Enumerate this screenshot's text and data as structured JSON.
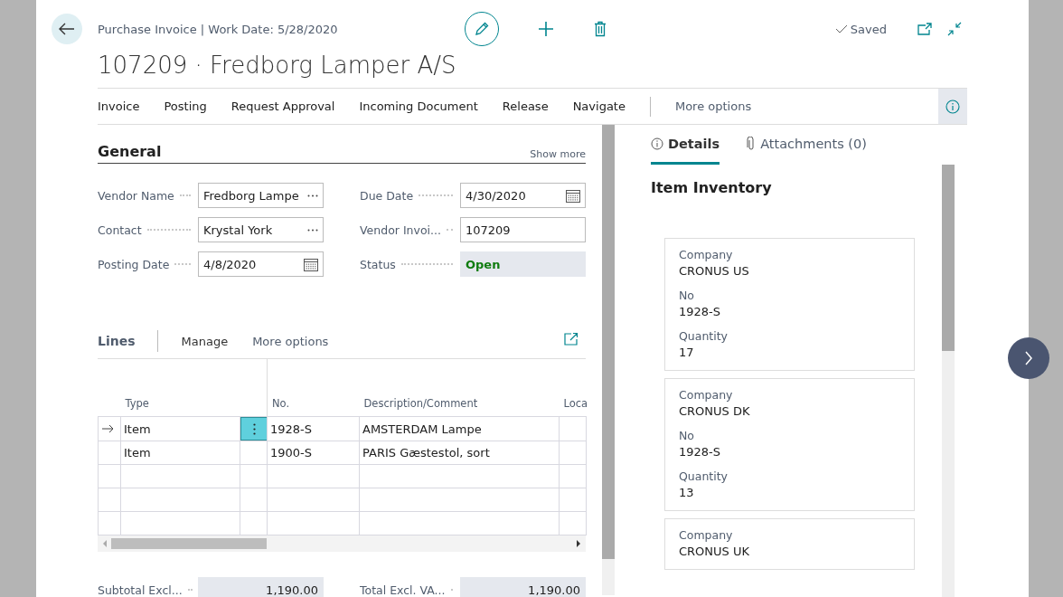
{
  "header": {
    "breadcrumb": "Purchase Invoice | Work Date: 5/28/2020",
    "title": "107209 · Fredborg Lamper A/S",
    "status": "Saved"
  },
  "action_bar": {
    "items": [
      "Invoice",
      "Posting",
      "Request Approval",
      "Incoming Document",
      "Release",
      "Navigate"
    ],
    "more": "More options"
  },
  "general": {
    "title": "General",
    "show_more": "Show more",
    "fields": [
      {
        "label": "Vendor Name",
        "value": "Fredborg Lampe",
        "kind": "lookup"
      },
      {
        "label": "Due Date",
        "value": "4/30/2020",
        "kind": "date"
      },
      {
        "label": "Contact",
        "value": "Krystal York",
        "kind": "lookup"
      },
      {
        "label": "Vendor Invoi...",
        "value": "107209",
        "kind": "text"
      },
      {
        "label": "Posting Date",
        "value": "4/8/2020",
        "kind": "date"
      },
      {
        "label": "Status",
        "value": "Open",
        "kind": "status"
      }
    ]
  },
  "lines": {
    "title": "Lines",
    "actions": [
      "Manage",
      "More options"
    ],
    "columns": [
      "Type",
      "No.",
      "Description/Comment",
      "Loca"
    ],
    "rows": [
      {
        "type": "Item",
        "no": "1928-S",
        "description": "AMSTERDAM Lampe",
        "selected": true
      },
      {
        "type": "Item",
        "no": "1900-S",
        "description": "PARIS Gæstestol, sort",
        "selected": false
      }
    ]
  },
  "totals": [
    {
      "label": "Subtotal Excl...",
      "value": "1,190.00"
    },
    {
      "label": "Total Excl. VA...",
      "value": "1,190.00"
    }
  ],
  "factbox": {
    "tabs": [
      {
        "label": "Details",
        "selected": true
      },
      {
        "label": "Attachments (0)",
        "selected": false
      }
    ],
    "title": "Item Inventory",
    "cards": [
      {
        "fields": [
          {
            "label": "Company",
            "value": "CRONUS US"
          },
          {
            "label": "No",
            "value": "1928-S"
          },
          {
            "label": "Quantity",
            "value": "17"
          }
        ]
      },
      {
        "fields": [
          {
            "label": "Company",
            "value": "CRONUS DK"
          },
          {
            "label": "No",
            "value": "1928-S"
          },
          {
            "label": "Quantity",
            "value": "13"
          }
        ]
      },
      {
        "fields": [
          {
            "label": "Company",
            "value": "CRONUS UK"
          }
        ]
      }
    ]
  }
}
